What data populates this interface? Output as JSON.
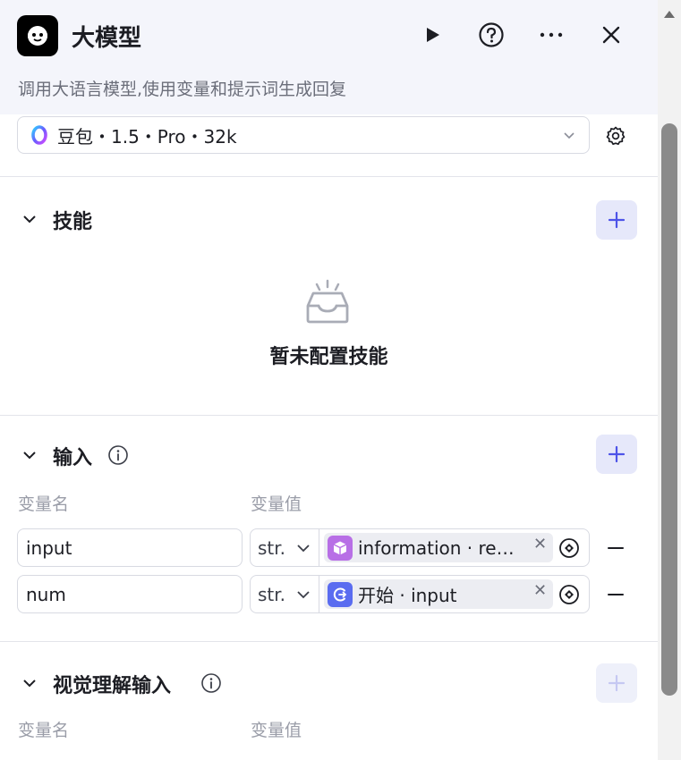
{
  "header": {
    "title": "大模型",
    "description": "调用大语言模型,使用变量和提示词生成回复",
    "icons": [
      "robot-icon",
      "play-icon",
      "help-icon",
      "more-icon",
      "close-icon"
    ]
  },
  "model": {
    "label": "豆包・1.5・Pro・32k",
    "icons": [
      "doubao-model-icon",
      "chevron-down-icon",
      "settings-gear-icon"
    ]
  },
  "skills": {
    "title": "技能",
    "empty_text": "暂未配置技能",
    "icons": [
      "chevron-down-icon",
      "plus-icon",
      "empty-inbox-icon"
    ]
  },
  "inputs": {
    "title": "输入",
    "col_name": "变量名",
    "col_value": "变量值",
    "rows": [
      {
        "name": "input",
        "type": "str.",
        "ref_label": "information · re…",
        "ref_icon": "cube-icon",
        "ref_color": "#b86fe6"
      },
      {
        "name": "num",
        "type": "str.",
        "ref_label": "开始 · input",
        "ref_icon": "start-node-icon",
        "ref_color": "#5a6cf0"
      }
    ],
    "icons": [
      "chevron-down-icon",
      "info-icon",
      "plus-icon",
      "minus-icon",
      "variable-icon"
    ]
  },
  "vision_inputs": {
    "title": "视觉理解输入",
    "col_name": "变量名",
    "col_value": "变量值",
    "icons": [
      "chevron-down-icon",
      "info-icon",
      "plus-icon"
    ]
  },
  "colors": {
    "header_bg": "#f4f5fb",
    "accent": "#4d53e8",
    "add_button_bg": "#e6e8fa"
  }
}
